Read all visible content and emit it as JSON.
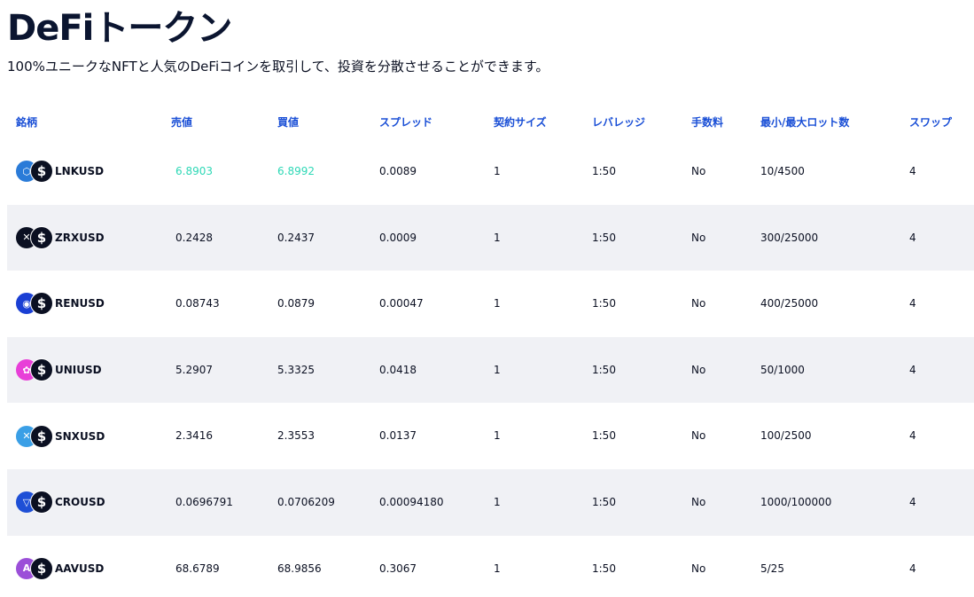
{
  "page": {
    "title": "DeFiトークン",
    "subtitle": "100%ユニークなNFTと人気のDeFiコインを取引して、投資を分散させることができます。"
  },
  "table": {
    "headers": [
      "銘柄",
      "売値",
      "買値",
      "スプレッド",
      "契約サイズ",
      "レバレッジ",
      "手数料",
      "最小/最大ロット数",
      "スワップ"
    ],
    "rows": [
      {
        "symbol": "LNKUSD",
        "icon": "chainlink-icon",
        "color": "#2a7bd8",
        "glyph": "⬡",
        "sell": "6.8903",
        "buy": "6.8992",
        "spread": "0.0089",
        "contract": "1",
        "leverage": "1:50",
        "fee": "No",
        "lots": "10/4500",
        "swap": "4"
      },
      {
        "symbol": "ZRXUSD",
        "icon": "zrx-icon",
        "color": "#0b1022",
        "glyph": "✕",
        "sell": "0.2428",
        "buy": "0.2437",
        "spread": "0.0009",
        "contract": "1",
        "leverage": "1:50",
        "fee": "No",
        "lots": "300/25000",
        "swap": "4"
      },
      {
        "symbol": "RENUSD",
        "icon": "ren-icon",
        "color": "#1a3fd4",
        "glyph": "◉",
        "sell": "0.08743",
        "buy": "0.0879",
        "spread": "0.00047",
        "contract": "1",
        "leverage": "1:50",
        "fee": "No",
        "lots": "400/25000",
        "swap": "4"
      },
      {
        "symbol": "UNIUSD",
        "icon": "uniswap-icon",
        "color": "#e83fd8",
        "glyph": "✿",
        "sell": "5.2907",
        "buy": "5.3325",
        "spread": "0.0418",
        "contract": "1",
        "leverage": "1:50",
        "fee": "No",
        "lots": "50/1000",
        "swap": "4"
      },
      {
        "symbol": "SNXUSD",
        "icon": "synthetix-icon",
        "color": "#3a9fe6",
        "glyph": "✕",
        "sell": "2.3416",
        "buy": "2.3553",
        "spread": "0.0137",
        "contract": "1",
        "leverage": "1:50",
        "fee": "No",
        "lots": "100/2500",
        "swap": "4"
      },
      {
        "symbol": "CROUSD",
        "icon": "cronos-icon",
        "color": "#1e4fd6",
        "glyph": "▽",
        "sell": "0.0696791",
        "buy": "0.0706209",
        "spread": "0.00094180",
        "contract": "1",
        "leverage": "1:50",
        "fee": "No",
        "lots": "1000/100000",
        "swap": "4"
      },
      {
        "symbol": "AAVUSD",
        "icon": "aave-icon",
        "color": "#9b4fd8",
        "glyph": "A",
        "sell": "68.6789",
        "buy": "68.9856",
        "spread": "0.3067",
        "contract": "1",
        "leverage": "1:50",
        "fee": "No",
        "lots": "5/25",
        "swap": "4"
      }
    ]
  },
  "colors": {
    "header_text": "#1a4fd6",
    "highlight_price": "#2ed8b6",
    "row_alt_bg": "#f0f1f5",
    "usd_coin": "#0b1022"
  },
  "usd_icon": {
    "name": "dollar-coin-icon",
    "glyph": "$"
  }
}
